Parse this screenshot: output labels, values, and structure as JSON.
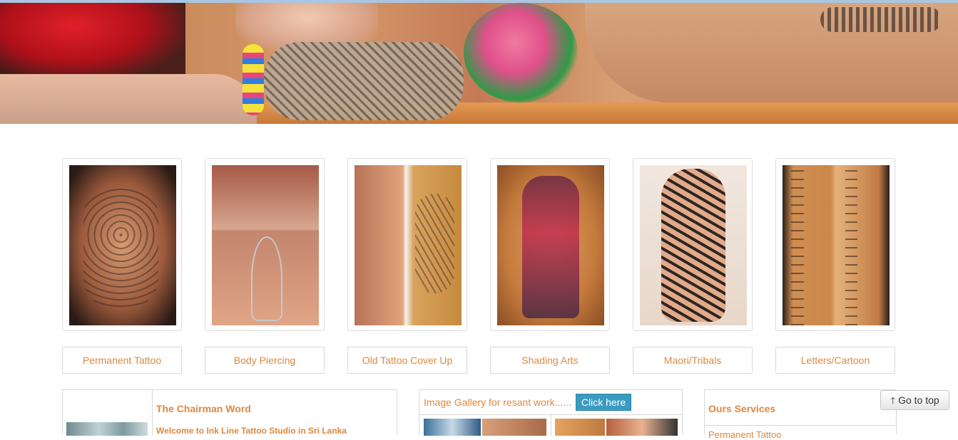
{
  "categories": [
    {
      "label": "Permanent Tattoo"
    },
    {
      "label": "Body Piercing"
    },
    {
      "label": "Old Tattoo Cover Up"
    },
    {
      "label": "Shading Arts"
    },
    {
      "label": "Maori/Tribals"
    },
    {
      "label": "Letters/Cartoon"
    }
  ],
  "chairman": {
    "title": "The Chairman Word",
    "welcome": "Welcome to Ink Line Tattoo Studio in Sri Lanka"
  },
  "gallery": {
    "header": "Image Gallery for resant work......",
    "button_label": "Click here"
  },
  "services": {
    "title": "Ours Services",
    "first_item": "Permanent Tattoo"
  },
  "go_top": {
    "label": "Go to top",
    "icon": "arrow-up-icon"
  }
}
